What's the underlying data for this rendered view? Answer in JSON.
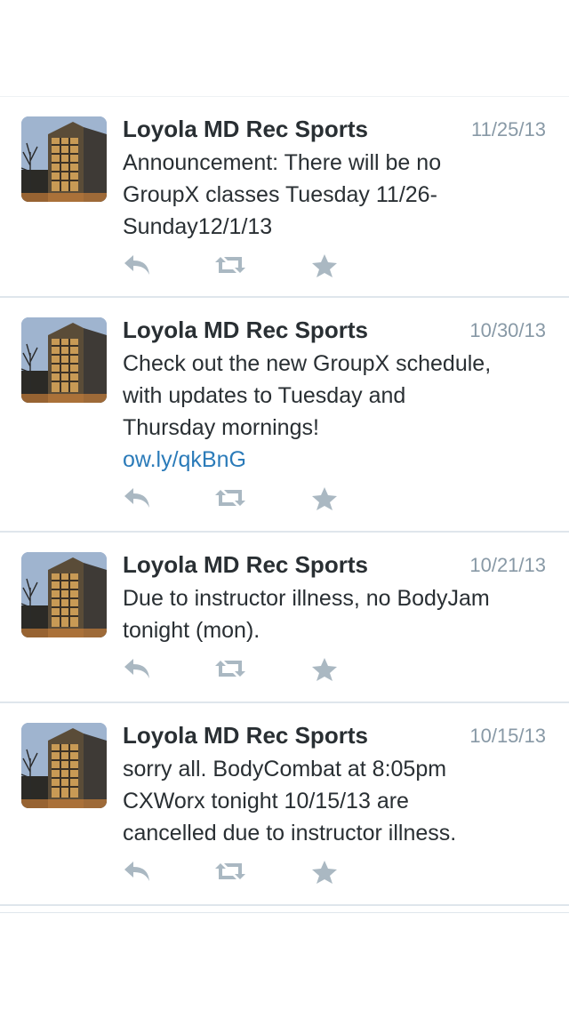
{
  "tweets": [
    {
      "name": "Loyola MD Rec Sports",
      "date": "11/25/13",
      "text_lines": [
        "Announcement: There will be no",
        "GroupX classes Tuesday 11/26-",
        "Sunday12/1/13"
      ],
      "link": ""
    },
    {
      "name": "Loyola MD Rec Sports",
      "date": "10/30/13",
      "text_lines": [
        "Check out the new GroupX schedule,",
        "with updates to Tuesday and",
        "Thursday mornings!"
      ],
      "link": "ow.ly/qkBnG"
    },
    {
      "name": "Loyola MD Rec Sports",
      "date": "10/21/13",
      "text_lines": [
        "Due to instructor illness, no BodyJam",
        "tonight (mon)."
      ],
      "link": ""
    },
    {
      "name": "Loyola MD Rec Sports",
      "date": "10/15/13",
      "text_lines": [
        "sorry all. BodyCombat at 8:05pm",
        "CXWorx tonight 10/15/13 are",
        "cancelled due to instructor illness."
      ],
      "link": ""
    }
  ],
  "icons": {
    "reply": "reply-icon",
    "retweet": "retweet-icon",
    "favorite": "star-icon"
  },
  "colors": {
    "text": "#292f33",
    "muted": "#8899a6",
    "link": "#2b7bb9",
    "icon": "#aab8c2",
    "divider": "#dfe6ec"
  }
}
